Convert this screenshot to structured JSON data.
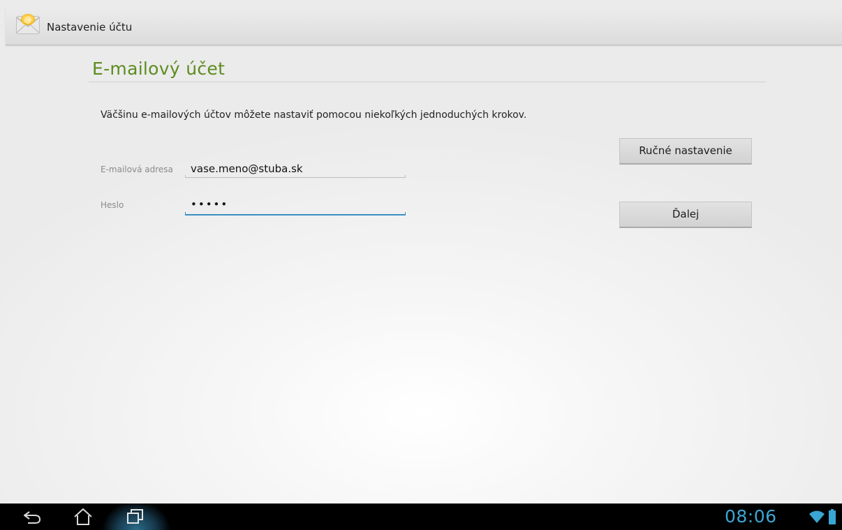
{
  "app_bar": {
    "title": "Nastavenie účtu",
    "icon": "email-app-icon"
  },
  "page": {
    "title": "E-mailový účet",
    "intro": "Väčšinu e-mailových účtov môžete nastaviť pomocou niekoľkých jednoduchých krokov."
  },
  "form": {
    "email_label": "E-mailová adresa",
    "email_value": "vase.meno@stuba.sk",
    "password_label": "Heslo",
    "password_value": "•••••"
  },
  "buttons": {
    "manual_setup": "Ručné nastavenie",
    "next": "Ďalej"
  },
  "system_bar": {
    "clock": "08:06",
    "icons": [
      "back-icon",
      "home-icon",
      "recent-apps-icon",
      "wifi-icon",
      "battery-icon"
    ]
  },
  "colors": {
    "title_green": "#5d8c1f",
    "focus_blue": "#3a8fc2",
    "clock_blue": "#3aa6d4"
  }
}
